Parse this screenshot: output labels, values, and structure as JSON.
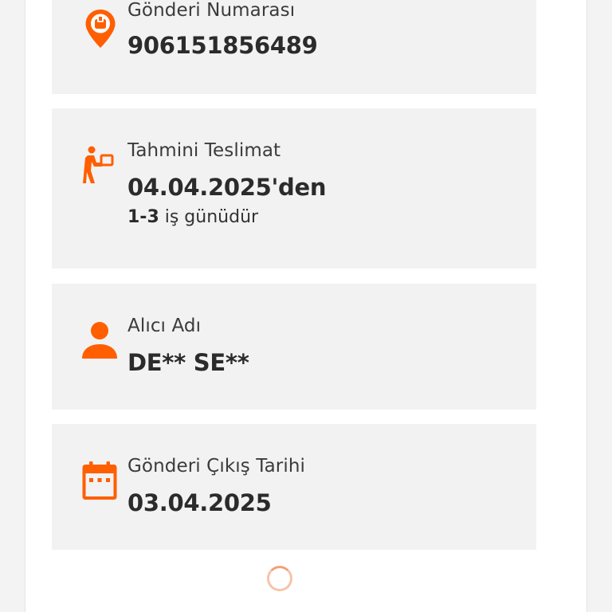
{
  "shipment": {
    "label": "Gönderi Numarası",
    "value": "906151856489",
    "icon": "location-pin-icon"
  },
  "delivery": {
    "label": "Tahmini Teslimat",
    "value": "04.04.2025'den",
    "note_range": "1-3",
    "note_text": " iş günüdür",
    "icon": "courier-delivery-icon"
  },
  "recipient": {
    "label": "Alıcı Adı",
    "value": "DE** SE**",
    "icon": "person-icon"
  },
  "departure": {
    "label": "Gönderi Çıkış Tarihi",
    "value": "03.04.2025",
    "icon": "calendar-icon"
  },
  "colors": {
    "accent": "#ff5f00",
    "card_background": "#f2f2f2",
    "page_background": "#ffffff"
  }
}
